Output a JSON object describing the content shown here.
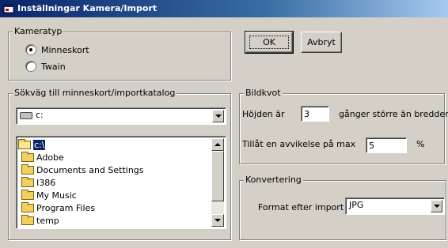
{
  "window": {
    "title": "Inställningar Kamera/Import"
  },
  "camera_type": {
    "legend": "Kameratyp",
    "options": [
      {
        "label": "Minneskort",
        "selected": true
      },
      {
        "label": "Twain",
        "selected": false
      }
    ]
  },
  "buttons": {
    "ok": "OK",
    "cancel": "Avbryt"
  },
  "path": {
    "legend": "Sökväg till minneskort/importkatalog",
    "drive": "c:",
    "folders": [
      {
        "label": "c:\\",
        "selected": true,
        "open": true
      },
      {
        "label": "Adobe"
      },
      {
        "label": "Documents and Settings"
      },
      {
        "label": "I386"
      },
      {
        "label": "My Music"
      },
      {
        "label": "Program Files"
      },
      {
        "label": "temp"
      }
    ]
  },
  "aspect": {
    "legend": "Bildkvot",
    "height_prefix": "Höjden är",
    "height_value": "3",
    "height_suffix": "gånger större än bredden",
    "tolerance_label": "Tillåt en avvikelse på max",
    "tolerance_value": "5",
    "tolerance_unit": "%"
  },
  "conversion": {
    "legend": "Konvertering",
    "format_label": "Format efter import",
    "format_value": "JPG"
  },
  "icons": {
    "title": "app-window-icon",
    "drive": "hard-drive-icon",
    "folder": "folder-icon"
  }
}
